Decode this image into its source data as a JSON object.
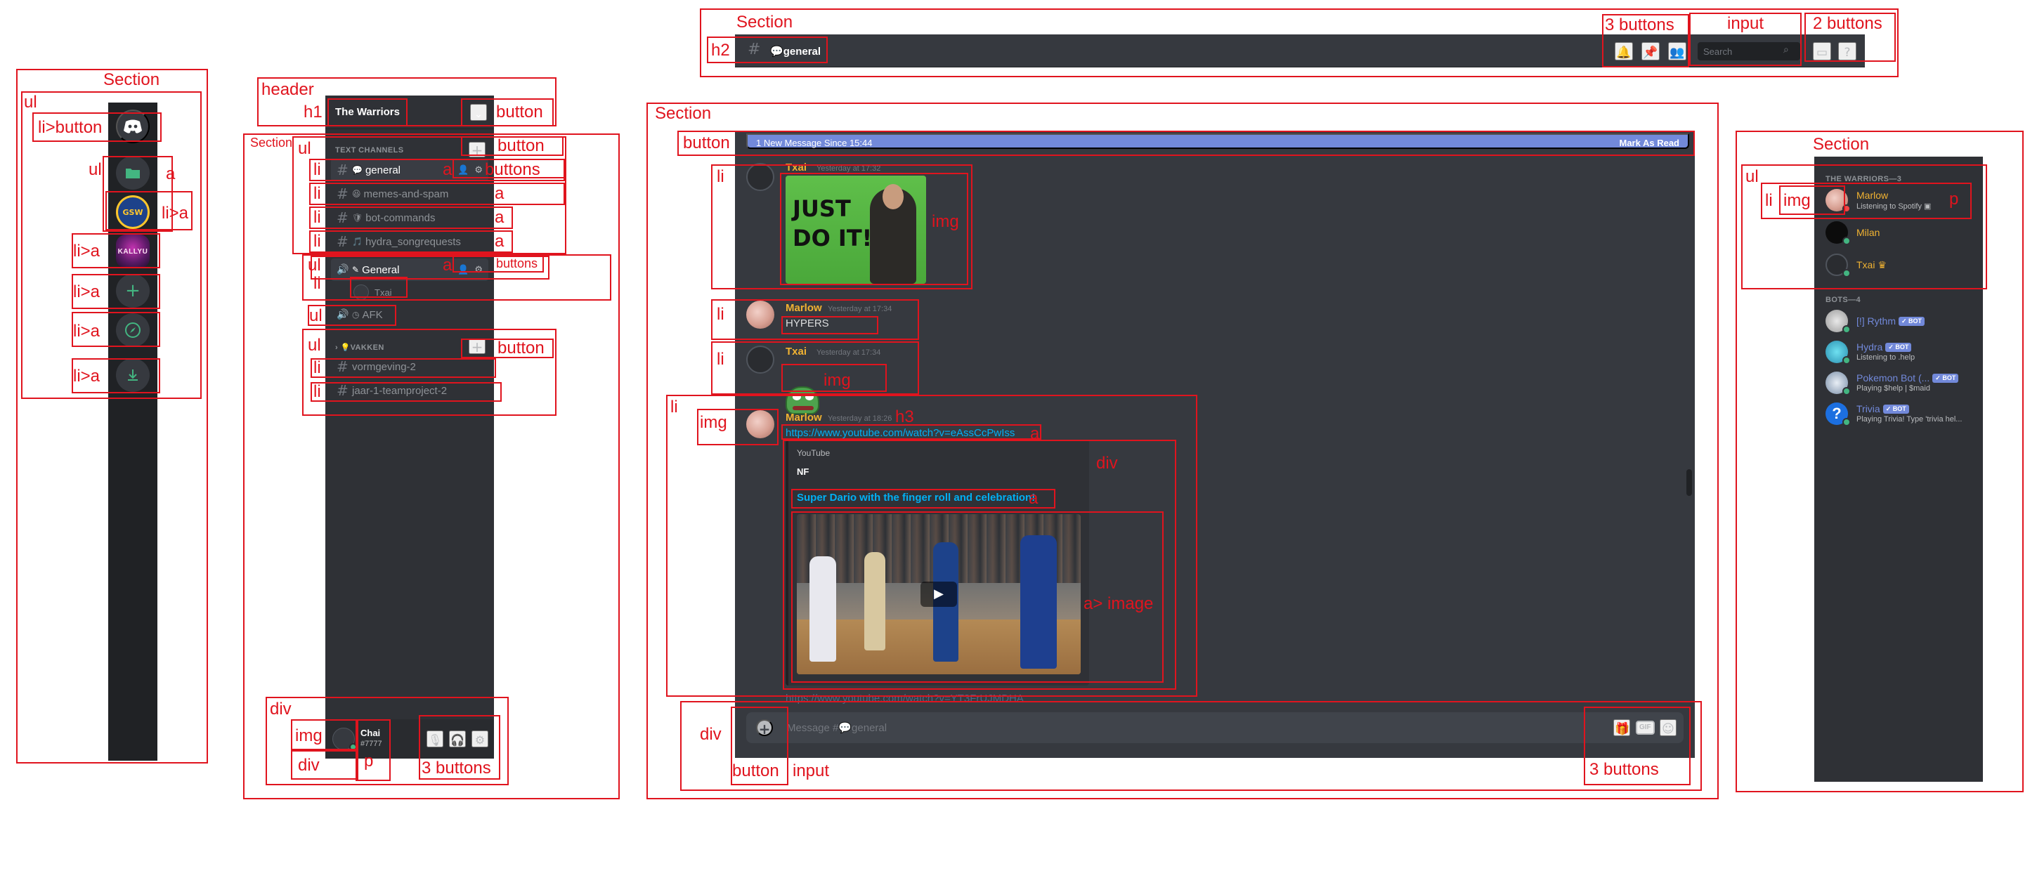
{
  "annotations": {
    "section": "Section",
    "ul": "ul",
    "li": "li",
    "li_button": "li>button",
    "li_a": "li>a",
    "a": "a",
    "header": "header",
    "h1": "h1",
    "h2": "h2",
    "h3": "h3",
    "button": "button",
    "buttons": "buttons",
    "two_buttons": "2 buttons",
    "three_buttons": "3 buttons",
    "input": "input",
    "img": "img",
    "p": "p",
    "div": "div",
    "a_image": "a>  image"
  },
  "server": {
    "name": "The Warriors",
    "gsw_text": "GSW",
    "kallyu_text": "KALLYU",
    "text_category": "TEXT CHANNELS",
    "text_channels": [
      {
        "name": "general",
        "emoji": "💬"
      },
      {
        "name": "memes-and-spam",
        "emoji": "😆"
      },
      {
        "name": "bot-commands",
        "emoji": "🛡"
      },
      {
        "name": "hydra_songrequests",
        "emoji": "🎵"
      }
    ],
    "voice_channel": {
      "name": "General",
      "emoji": "✎",
      "user": "Txai"
    },
    "afk_channel": "AFK",
    "vakken_category": "VAKKEN",
    "vakken_channels": [
      "vormgeving-2",
      "jaar-1-teamproject-2"
    ]
  },
  "user": {
    "name": "Chai",
    "tag": "#7777"
  },
  "topbar": {
    "channel_name": "general",
    "search_placeholder": "Search"
  },
  "chat": {
    "new_messages": "1 New Message Since 15:44",
    "mark_as_read": "Mark As Read",
    "messages": [
      {
        "author": "Txai",
        "time": "Yesterday at 17:32",
        "gif_text_1": "JUST",
        "gif_text_2": "DO IT!"
      },
      {
        "author": "Marlow",
        "time": "Yesterday at 17:34",
        "text": "HYPERS"
      },
      {
        "author": "Txai",
        "time": "Yesterday at 17:34"
      },
      {
        "author": "Marlow",
        "time": "Yesterday at 18:26",
        "link": "https://www.youtube.com/watch?v=eAssCcPwIss"
      }
    ],
    "embed": {
      "provider": "YouTube",
      "author": "NF",
      "title": "Super Dario with the finger roll and celebration!"
    },
    "next_link": "https://www.youtube.com/watch?v=YT3FrUJMDHA",
    "composer_placeholder": "Message #💬general",
    "gif_label": "GIF"
  },
  "members": {
    "warriors_category": "THE WARRIORS—3",
    "warriors": [
      {
        "name": "Marlow",
        "activity": "Listening to Spotify",
        "color": "#f0b232"
      },
      {
        "name": "Milan",
        "activity": "",
        "color": "#f0b232"
      },
      {
        "name": "Txai",
        "activity": "",
        "color": "#f0b232",
        "crown": "♛"
      }
    ],
    "bots_category": "BOTS—4",
    "bot_tag": "✓ BOT",
    "bots": [
      {
        "name": "[!] Rythm",
        "activity": "",
        "color": "#7289da"
      },
      {
        "name": "Hydra",
        "activity": "Listening to .help",
        "color": "#7289da"
      },
      {
        "name": "Pokemon Bot (...",
        "activity": "Playing $help | $maid",
        "color": "#7289da"
      },
      {
        "name": "Trivia",
        "activity": "Playing Trivia! Type 'trivia hel...",
        "color": "#7289da"
      }
    ]
  },
  "colors": {
    "blurple": "#7289da",
    "online": "#43b581",
    "dnd": "#f04747",
    "gold": "#f0b232",
    "annotation": "#e0141e"
  }
}
